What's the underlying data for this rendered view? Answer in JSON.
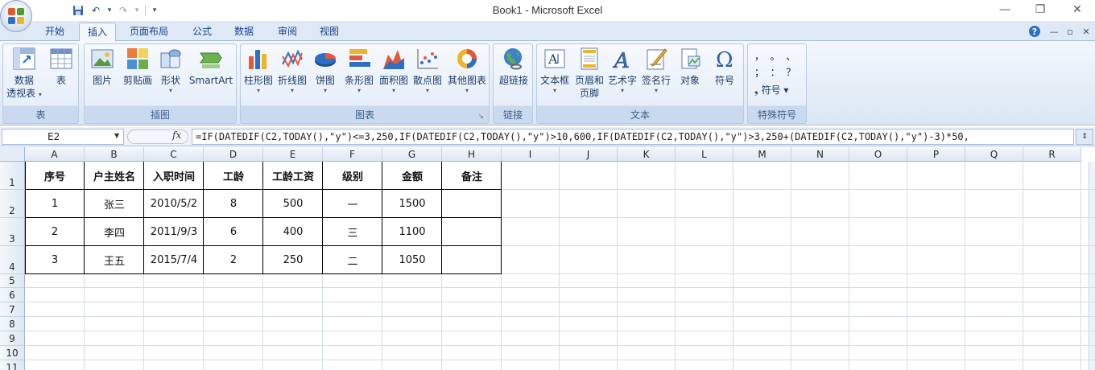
{
  "window": {
    "title": "Book1 - Microsoft Excel",
    "minimize": "—",
    "restore": "❐",
    "close": "✕"
  },
  "qat": {
    "undo": "↶",
    "redo": "↷",
    "dropdown": "▾"
  },
  "tabs": [
    {
      "label": "开始"
    },
    {
      "label": "插入",
      "active": true
    },
    {
      "label": "页面布局"
    },
    {
      "label": "公式"
    },
    {
      "label": "数据"
    },
    {
      "label": "审阅"
    },
    {
      "label": "视图"
    }
  ],
  "tab_right": {
    "help": "?",
    "min": "—",
    "restore": "▫",
    "close": "✕"
  },
  "ribbon": {
    "groups": {
      "table": {
        "label": "表",
        "pivot_line1": "数据",
        "pivot_line2": "透视表",
        "table": "表"
      },
      "illustrations": {
        "label": "插图",
        "picture": "图片",
        "clipart": "剪贴画",
        "shapes": "形状",
        "smartart": "SmartArt"
      },
      "charts": {
        "label": "图表",
        "column": "柱形图",
        "line": "折线图",
        "pie": "饼图",
        "bar": "条形图",
        "area": "面积图",
        "scatter": "散点图",
        "other": "其他图表"
      },
      "links": {
        "label": "链接",
        "hyperlink": "超链接"
      },
      "text": {
        "label": "文本",
        "textbox": "文本框",
        "header_line1": "页眉和",
        "header_line2": "页脚",
        "wordart": "艺术字",
        "signature": "签名行",
        "object": "对象",
        "symbol": "符号"
      },
      "special": {
        "label": "特殊符号",
        "symbols_row1": "，  。  、",
        "symbols_row2": "；  ：  ？",
        "symbol": "符号"
      }
    }
  },
  "formula_bar": {
    "name_box": "E2",
    "fx": "fx",
    "formula": "=IF(DATEDIF(C2,TODAY(),\"y\")<=3,250,IF(DATEDIF(C2,TODAY(),\"y\")>10,600,IF(DATEDIF(C2,TODAY(),\"y\")>3,250+(DATEDIF(C2,TODAY(),\"y\")-3)*50,"
  },
  "sheet": {
    "columns": [
      "A",
      "B",
      "C",
      "D",
      "E",
      "F",
      "G",
      "H",
      "I",
      "J",
      "K",
      "L",
      "M",
      "N",
      "O",
      "P",
      "Q",
      "R"
    ],
    "rows": [
      "1",
      "2",
      "3",
      "4",
      "5",
      "6",
      "7",
      "8",
      "9",
      "10",
      "11"
    ],
    "headers": [
      "序号",
      "户主姓名",
      "入职时间",
      "工龄",
      "工龄工资",
      "级别",
      "金额",
      "备注"
    ],
    "data": [
      [
        "1",
        "张三",
        "2010/5/2",
        "8",
        "500",
        "一",
        "1500",
        ""
      ],
      [
        "2",
        "李四",
        "2011/9/3",
        "6",
        "400",
        "三",
        "1100",
        ""
      ],
      [
        "3",
        "王五",
        "2015/7/4",
        "2",
        "250",
        "二",
        "1050",
        ""
      ]
    ]
  }
}
